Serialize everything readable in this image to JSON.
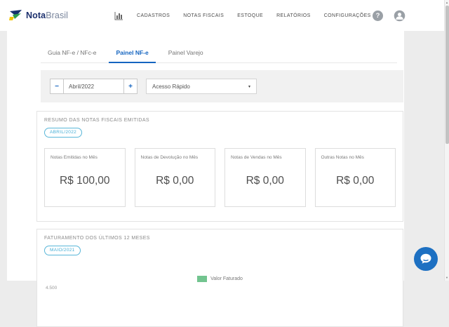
{
  "brand": {
    "name_bold": "Nota",
    "name_light": "Brasil"
  },
  "header": {
    "nav": [
      "CADASTROS",
      "NOTAS FISCAIS",
      "ESTOQUE",
      "RELATÓRIOS",
      "CONFIGURAÇÕES"
    ],
    "help_glyph": "?"
  },
  "tabs": [
    {
      "label": "Guia NF-e / NFc-e",
      "active": false
    },
    {
      "label": "Painel NF-e",
      "active": true
    },
    {
      "label": "Painel Varejo",
      "active": false
    }
  ],
  "filters": {
    "minus_glyph": "−",
    "plus_glyph": "+",
    "month_value": "Abril/2022",
    "quick_access_label": "Acesso Rápido",
    "caret_glyph": "▾"
  },
  "resumo_card": {
    "title": "RESUMO DAS NOTAS FISCAIS EMITIDAS",
    "badge": "ABRIL/2022",
    "stats": [
      {
        "label": "Notas Emitidas no Mês",
        "value": "R$ 100,00"
      },
      {
        "label": "Notas de Devolução no Mês",
        "value": "R$ 0,00"
      },
      {
        "label": "Notas de Vendas no Mês",
        "value": "R$ 0,00"
      },
      {
        "label": "Outras Notas no Mês",
        "value": "R$ 0,00"
      }
    ]
  },
  "faturamento_card": {
    "title": "FATURAMENTO DOS ÚLTIMOS 12 MESES",
    "badge": "MAIO/2021",
    "legend_label": "Valor Faturado",
    "partial_axis_tick": "4.500"
  },
  "scrollbar": {
    "up_glyph": "▲",
    "down_glyph": "▼"
  },
  "colors": {
    "accent_blue": "#1565c0",
    "badge_blue": "#45aed6",
    "legend_green": "#72c48f",
    "chat_blue": "#1d70c2",
    "logo_navy": "#1b2f6d"
  }
}
